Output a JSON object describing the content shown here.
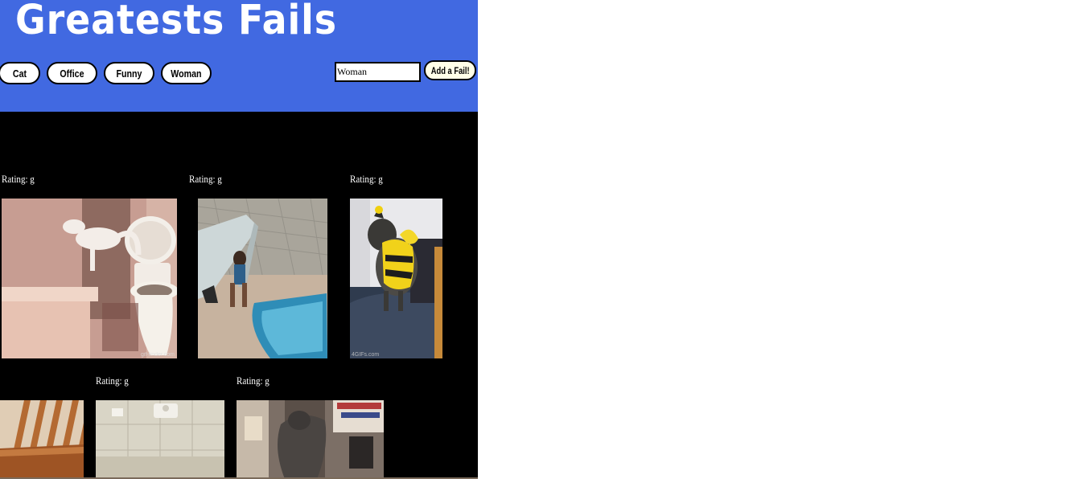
{
  "header": {
    "title": "Greatests Fails",
    "background_color": "#4169e1"
  },
  "categories": [
    {
      "label": "Cat"
    },
    {
      "label": "Office"
    },
    {
      "label": "Funny"
    },
    {
      "label": "Woman"
    }
  ],
  "search": {
    "value": "Woman"
  },
  "add_button": {
    "label": "Add a Fail!"
  },
  "gifs": [
    {
      "rating": "Rating: g",
      "alt": "cat falling into toilet",
      "watermark": "gif-finder.com"
    },
    {
      "rating": "Rating: g",
      "alt": "kid slipping by pool slide",
      "watermark": ""
    },
    {
      "rating": "Rating: g",
      "alt": "cat in bee costume",
      "watermark": "4GIFs.com"
    },
    {
      "rating": "",
      "alt": "wooden chair",
      "watermark": ""
    },
    {
      "rating": "Rating: g",
      "alt": "white tiled bathroom",
      "watermark": ""
    },
    {
      "rating": "Rating: g",
      "alt": "cat jumping in shop",
      "watermark": ""
    }
  ],
  "content_background": "#000000"
}
